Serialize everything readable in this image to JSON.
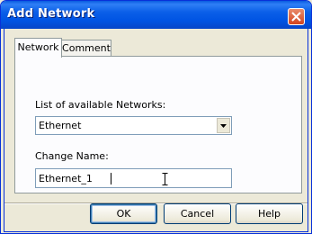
{
  "window": {
    "title": "Add Network",
    "close_icon": "close-x-icon"
  },
  "tabs": [
    {
      "label": "Network",
      "active": true
    },
    {
      "label": "Comment",
      "active": false
    }
  ],
  "network_panel": {
    "networks_label": "List of available Networks:",
    "network_selected": "Ethernet",
    "change_name_label": "Change Name:",
    "name_value": "Ethernet_1"
  },
  "buttons": {
    "ok": "OK",
    "cancel": "Cancel",
    "help": "Help"
  },
  "colors": {
    "titlebar": "#0054e3",
    "close": "#d3451f",
    "face": "#ece9d8",
    "border": "#0831d9"
  }
}
